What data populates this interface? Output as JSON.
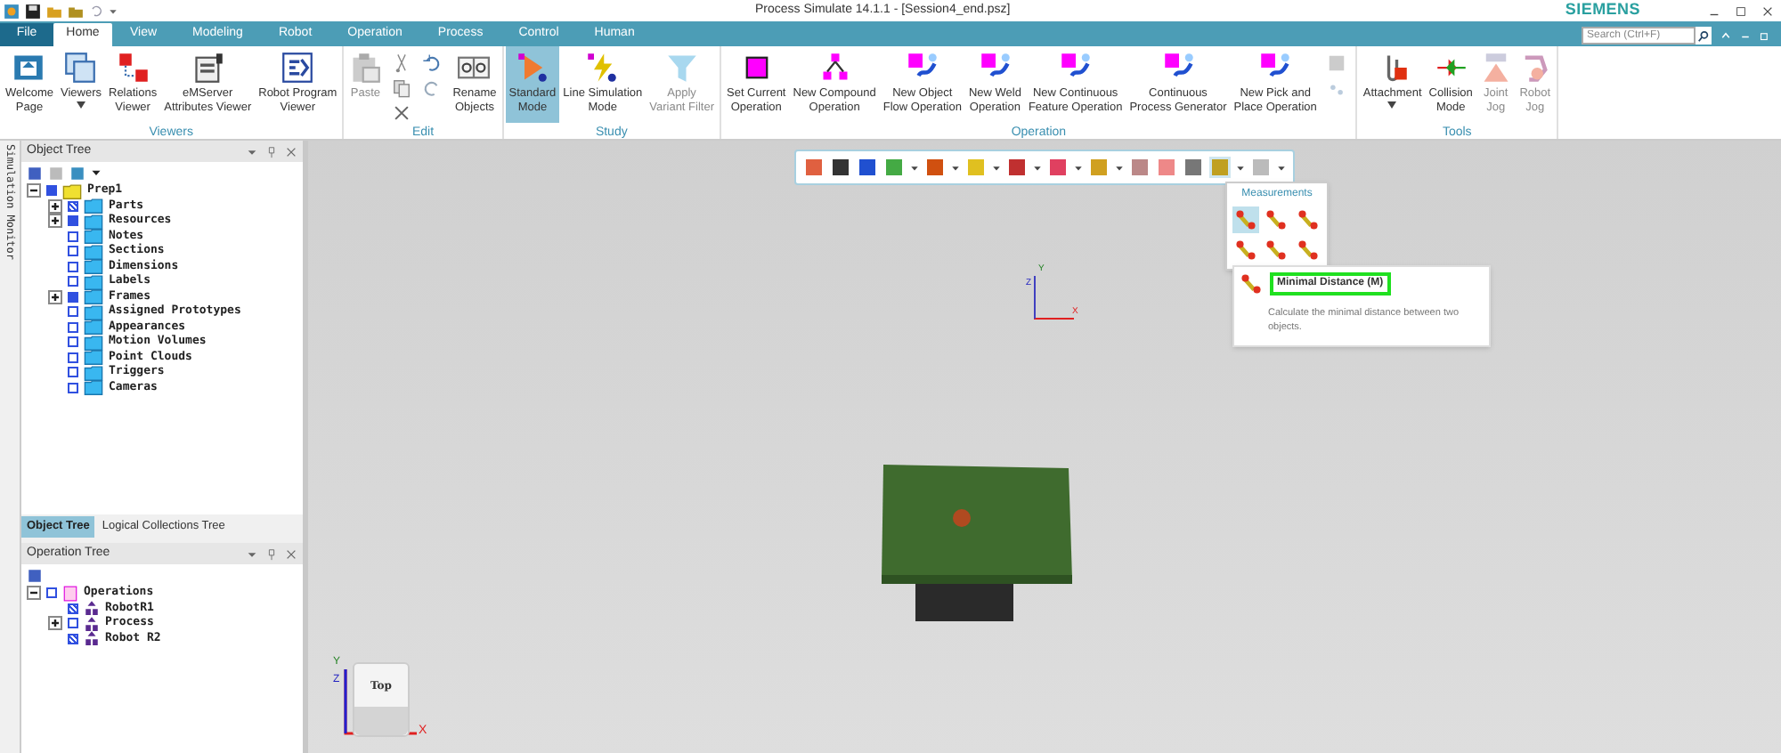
{
  "window": {
    "title": "Process Simulate 14.1.1 - [Session4_end.psz]",
    "brand": "SIEMENS"
  },
  "tabs": [
    {
      "label": "File",
      "kind": "file",
      "selected": false
    },
    {
      "label": "Home",
      "kind": "tab",
      "selected": true
    },
    {
      "label": "View",
      "kind": "tab",
      "selected": false
    },
    {
      "label": "Modeling",
      "kind": "tab",
      "selected": false
    },
    {
      "label": "Robot",
      "kind": "tab",
      "selected": false
    },
    {
      "label": "Operation",
      "kind": "tab",
      "selected": false
    },
    {
      "label": "Process",
      "kind": "tab",
      "selected": false
    },
    {
      "label": "Control",
      "kind": "tab",
      "selected": false
    },
    {
      "label": "Human",
      "kind": "tab",
      "selected": false
    }
  ],
  "search": {
    "placeholder": "Search (Ctrl+F)"
  },
  "ribbon_groups": [
    {
      "name": "Viewers",
      "buttons": [
        {
          "label": "Welcome\nPage",
          "disabled": false,
          "selected": false,
          "dropdown": false
        },
        {
          "label": "Viewers",
          "disabled": false,
          "selected": false,
          "dropdown": true
        },
        {
          "label": "Relations\nViewer",
          "disabled": false,
          "selected": false,
          "dropdown": false
        },
        {
          "label": "eMServer\nAttributes Viewer",
          "disabled": false,
          "selected": false,
          "dropdown": false
        },
        {
          "label": "Robot Program\nViewer",
          "disabled": false,
          "selected": false,
          "dropdown": false
        }
      ]
    },
    {
      "name": "Edit",
      "buttons": [
        {
          "label": "Paste",
          "disabled": true,
          "selected": false,
          "dropdown": false
        },
        {
          "kind": "small-tools"
        },
        {
          "label": "Rename\nObjects",
          "disabled": false,
          "selected": false,
          "dropdown": false
        }
      ]
    },
    {
      "name": "Study",
      "buttons": [
        {
          "label": "Standard\nMode",
          "disabled": false,
          "selected": true,
          "dropdown": false
        },
        {
          "label": "Line Simulation\nMode",
          "disabled": false,
          "selected": false,
          "dropdown": false
        },
        {
          "label": "Apply\nVariant Filter",
          "disabled": true,
          "selected": false,
          "dropdown": false
        }
      ]
    },
    {
      "name": "Operation",
      "buttons": [
        {
          "label": "Set Current\nOperation",
          "disabled": false,
          "selected": false,
          "dropdown": false
        },
        {
          "label": "New Compound\nOperation",
          "disabled": false,
          "selected": false,
          "dropdown": false
        },
        {
          "label": "New Object\nFlow Operation",
          "disabled": false,
          "selected": false,
          "dropdown": false
        },
        {
          "label": "New Weld\nOperation",
          "disabled": false,
          "selected": false,
          "dropdown": false
        },
        {
          "label": "New Continuous\nFeature Operation",
          "disabled": false,
          "selected": false,
          "dropdown": false
        },
        {
          "label": "Continuous\nProcess Generator",
          "disabled": false,
          "selected": false,
          "dropdown": false
        },
        {
          "label": "New Pick and\nPlace Operation",
          "disabled": false,
          "selected": false,
          "dropdown": false
        },
        {
          "kind": "small-stack"
        }
      ]
    },
    {
      "name": "Tools",
      "buttons": [
        {
          "label": "Attachment",
          "disabled": false,
          "selected": false,
          "dropdown": true
        },
        {
          "label": "Collision\nMode",
          "disabled": false,
          "selected": false,
          "dropdown": false
        },
        {
          "label": "Joint\nJog",
          "disabled": true,
          "selected": false,
          "dropdown": false
        },
        {
          "label": "Robot\nJog",
          "disabled": true,
          "selected": false,
          "dropdown": false
        }
      ]
    }
  ],
  "side_strip": {
    "label": "Simulation Monitor"
  },
  "object_tree": {
    "title": "Object Tree",
    "items": [
      {
        "label": "Prep1",
        "checked": true,
        "partial": false,
        "expanded": true,
        "children": [
          {
            "label": "Parts",
            "checked": false,
            "partial": true,
            "expanded": false
          },
          {
            "label": "Resources",
            "checked": true,
            "partial": false,
            "expanded": false
          },
          {
            "label": "Notes",
            "checked": false,
            "partial": false
          },
          {
            "label": "Sections",
            "checked": false,
            "partial": false
          },
          {
            "label": "Dimensions",
            "checked": false,
            "partial": false
          },
          {
            "label": "Labels",
            "checked": false,
            "partial": false
          },
          {
            "label": "Frames",
            "checked": true,
            "partial": false,
            "expanded": false
          },
          {
            "label": "Assigned Prototypes",
            "checked": false,
            "partial": false
          },
          {
            "label": "Appearances",
            "checked": false,
            "partial": false
          },
          {
            "label": "Motion Volumes",
            "checked": false,
            "partial": false
          },
          {
            "label": "Point Clouds",
            "checked": false,
            "partial": false
          },
          {
            "label": "Triggers",
            "checked": false,
            "partial": false
          },
          {
            "label": "Cameras",
            "checked": false,
            "partial": false
          }
        ]
      }
    ]
  },
  "tree_tabs": [
    {
      "label": "Object Tree",
      "selected": true
    },
    {
      "label": "Logical Collections Tree",
      "selected": false
    }
  ],
  "operation_tree": {
    "title": "Operation Tree",
    "items": [
      {
        "label": "Operations",
        "checked": false,
        "partial": false,
        "expanded": true,
        "children": [
          {
            "label": "RobotR1",
            "checked": false,
            "partial": true
          },
          {
            "label": "Process",
            "checked": false,
            "partial": false,
            "expanded": false
          },
          {
            "label": "Robot R2",
            "checked": false,
            "partial": true
          }
        ]
      }
    ]
  },
  "measurements": {
    "title": "Measurements",
    "tools": [
      {
        "selected": true
      },
      {
        "selected": false
      },
      {
        "selected": false
      },
      {
        "selected": false
      },
      {
        "selected": false
      },
      {
        "selected": false
      }
    ]
  },
  "tooltip": {
    "title": "Minimal Distance (M)",
    "description": "Calculate the minimal distance between two objects.",
    "highlighted": true
  },
  "axis": {
    "x": "X",
    "y": "Y",
    "z": "Z"
  },
  "view_cube": {
    "face": "Top",
    "axis_x": "X",
    "axis_y": "Y",
    "axis_z": "Z"
  }
}
